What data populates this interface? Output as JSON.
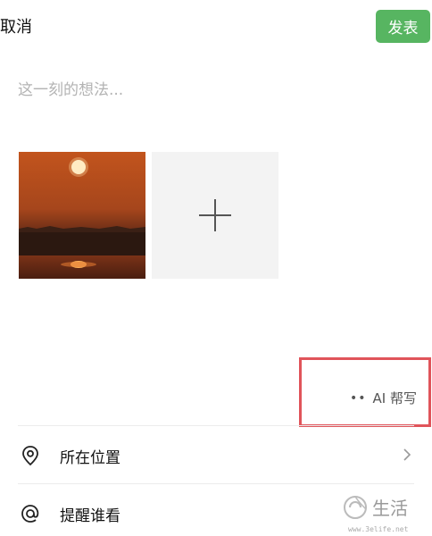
{
  "header": {
    "cancel_label": "取消",
    "publish_label": "发表",
    "publish_color": "#57b561"
  },
  "composer": {
    "placeholder": "这一刻的想法..."
  },
  "media": {
    "add_label": "+"
  },
  "ai_write": {
    "label": "AI 帮写"
  },
  "highlight_color": "#e0545a",
  "options": [
    {
      "label": "所在位置",
      "icon": "location-pin-icon"
    },
    {
      "label": "提醒谁看",
      "icon": "at-sign-icon"
    }
  ],
  "watermark": {
    "text": "生活",
    "url": "www.3elife.net"
  }
}
